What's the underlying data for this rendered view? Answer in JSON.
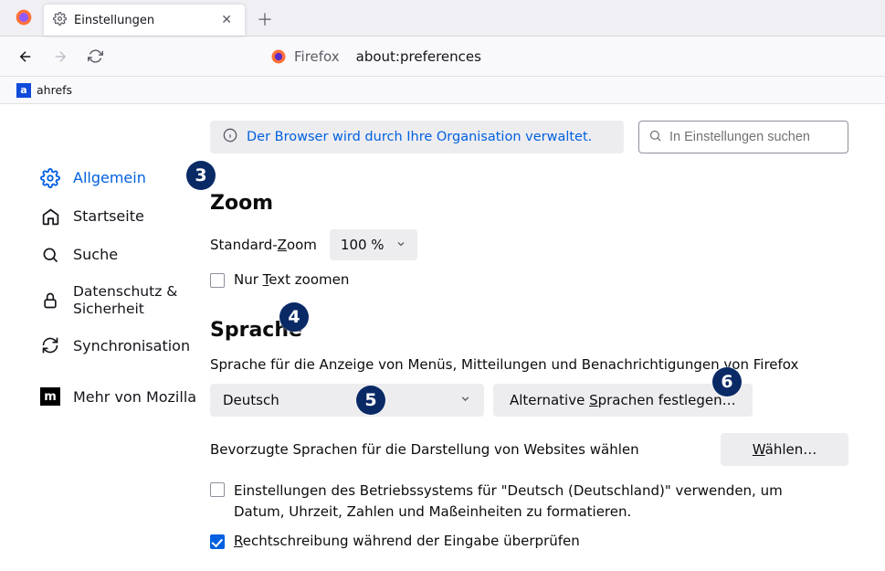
{
  "tab": {
    "title": "Einstellungen"
  },
  "address": {
    "appname": "Firefox",
    "url": "about:preferences"
  },
  "bookmark": {
    "label": "ahrefs",
    "icon_text": "a"
  },
  "banner": {
    "text": "Der Browser wird durch Ihre Organisation verwaltet."
  },
  "search": {
    "placeholder": "In Einstellungen suchen"
  },
  "sidebar": {
    "items": [
      {
        "label": "Allgemein"
      },
      {
        "label": "Startseite"
      },
      {
        "label": "Suche"
      },
      {
        "label": "Datenschutz & Sicherheit"
      },
      {
        "label": "Synchronisation"
      },
      {
        "label": "Mehr von Mozilla"
      }
    ]
  },
  "zoom": {
    "heading": "Zoom",
    "default_label_pre": "Standard-",
    "default_label_u": "Z",
    "default_label_post": "oom",
    "value": "100 %",
    "textonly_pre": "Nur ",
    "textonly_u": "T",
    "textonly_post": "ext zoomen"
  },
  "lang": {
    "heading": "Sprache",
    "desc": "Sprache für die Anzeige von Menüs, Mitteilungen und Benachrichtigungen von Firefox",
    "selected": "Deutsch",
    "alt_button_pre": "Alternative ",
    "alt_button_u": "S",
    "alt_button_post": "prachen festlegen…",
    "sites_desc": "Bevorzugte Sprachen für die Darstellung von Websites wählen",
    "choose_u": "W",
    "choose_post": "ählen…",
    "os_settings": "Einstellungen des Betriebssystems für \"Deutsch (Deutschland)\" verwenden, um Datum, Uhrzeit, Zahlen und Maßeinheiten zu formatieren.",
    "spell_u": "R",
    "spell_post": "echtschreibung während der Eingabe überprüfen"
  },
  "badges": {
    "b3": "3",
    "b4": "4",
    "b5": "5",
    "b6": "6"
  }
}
